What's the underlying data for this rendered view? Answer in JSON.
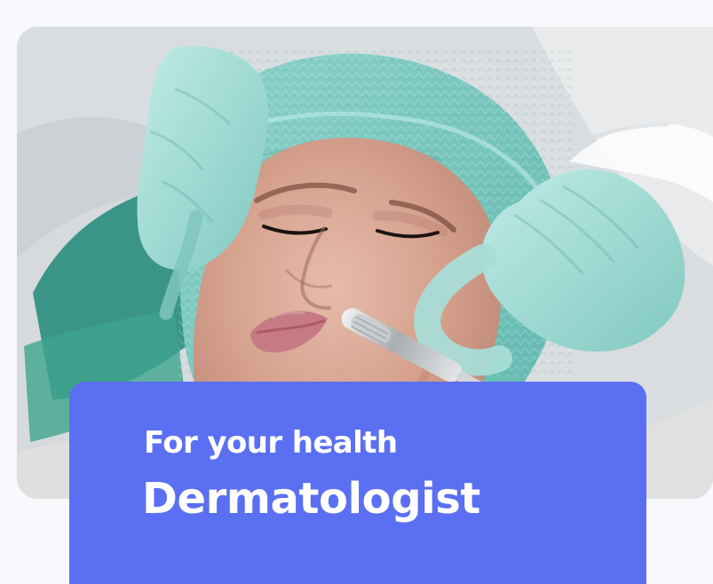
{
  "card": {
    "eyebrow": "For your health",
    "title": "Dermatologist"
  },
  "image": {
    "subject": "dermatology-treatment-photo"
  },
  "colors": {
    "caption_background": "#5b6ff2",
    "caption_text": "#ffffff",
    "page_background": "#f8f9fc",
    "glove": "#9fd6cf",
    "cap": "#72c6bd",
    "towel": "#3f9f8d"
  }
}
